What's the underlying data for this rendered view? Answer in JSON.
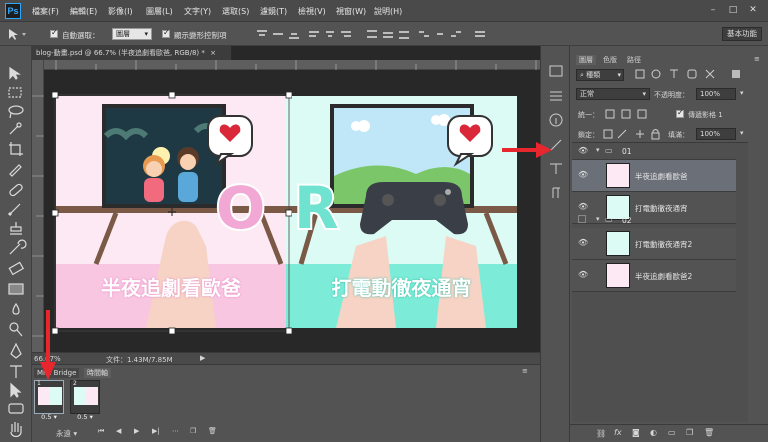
{
  "app": {
    "logo": "Ps"
  },
  "menu": [
    "檔案(F)",
    "編輯(E)",
    "影像(I)",
    "圖層(L)",
    "文字(Y)",
    "選取(S)",
    "濾鏡(T)",
    "檢視(V)",
    "視窗(W)",
    "說明(H)"
  ],
  "window_controls": [
    "–",
    "□",
    "✕"
  ],
  "options": {
    "auto_select_label": "自動選取：",
    "auto_select_value": "圖層",
    "show_transform_label": "顯示變形控制項",
    "workspace_button": "基本功能"
  },
  "document": {
    "tab_title": "blog-動畫.psd @ 66.7% (半夜追劇看歐爸, RGB/8) *",
    "zoom": "66.67%",
    "doc_size": "文件：1.43M/7.85M",
    "canvas": {
      "left_caption": "半夜追劇看歐爸",
      "right_caption": "打電動徹夜通宵",
      "or_letters": "OR"
    }
  },
  "timeline": {
    "tabs": [
      "Mini Bridge",
      "時間軸"
    ],
    "frames": [
      {
        "number": "1",
        "duration": "0.5"
      },
      {
        "number": "2",
        "duration": "0.5"
      }
    ],
    "loop": "永遠"
  },
  "layers_panel": {
    "tabs": [
      "圖層",
      "色版",
      "路徑"
    ],
    "filter_kind": "種類",
    "blend_mode": "正常",
    "opacity_label": "不透明度：",
    "opacity_value": "100%",
    "unify_label": "統一：",
    "propagate_label": "傳遞影格 1",
    "lock_label": "鎖定：",
    "fill_label": "填滿：",
    "fill_value": "100%",
    "layers": [
      {
        "type": "group",
        "name": "01"
      },
      {
        "type": "layer",
        "name": "半夜追劇看歐爸",
        "selected": true
      },
      {
        "type": "layer",
        "name": "打電動徹夜通宵",
        "selected": false
      },
      {
        "type": "group",
        "name": "02"
      },
      {
        "type": "layer",
        "name": "打電動徹夜通宵2",
        "selected": false
      },
      {
        "type": "layer",
        "name": "半夜追劇看歐爸2",
        "selected": false
      }
    ]
  },
  "colors": {
    "accent_red": "#e8262e",
    "left_bg": "#fde9f3",
    "left_banner": "#f9c6e2",
    "right_bg": "#dcfbf5",
    "right_banner": "#7cecd8"
  }
}
